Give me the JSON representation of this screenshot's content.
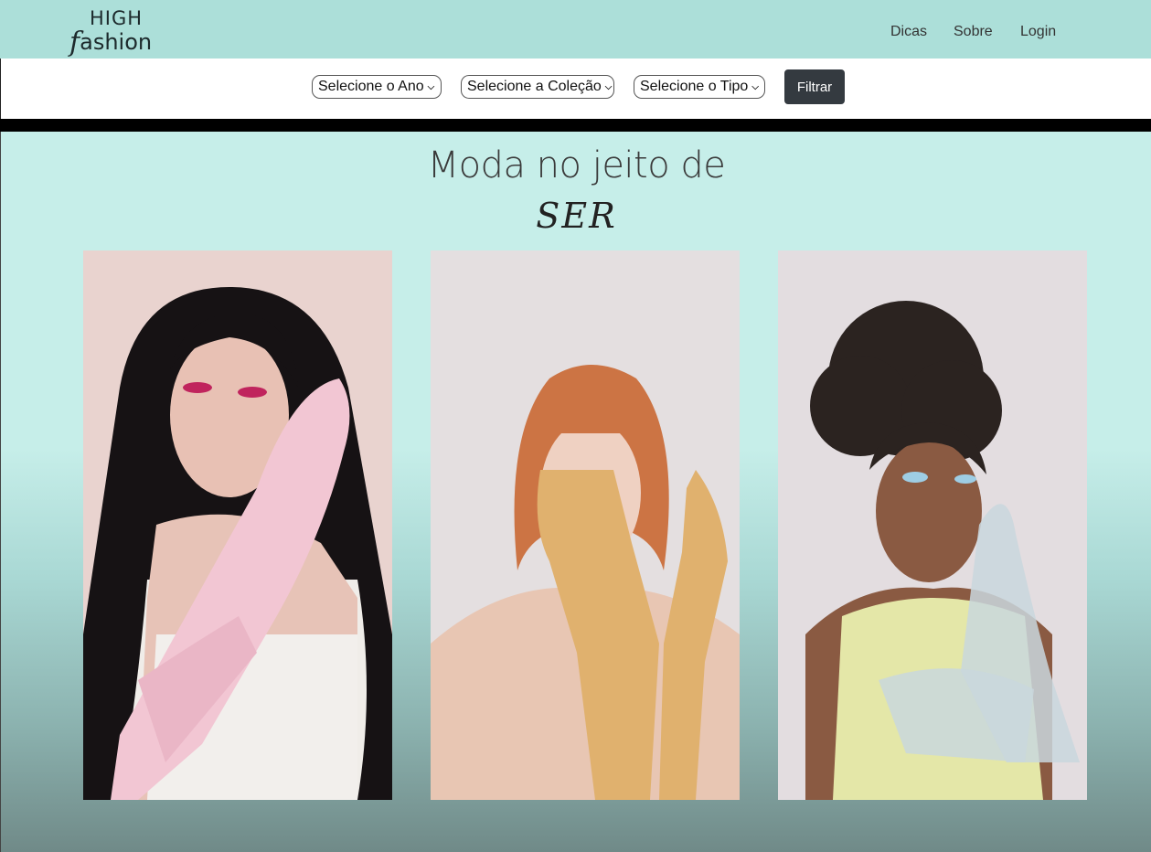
{
  "brand": {
    "line1": "HIGH",
    "line2_first": "f",
    "line2_rest": "ashion"
  },
  "nav": {
    "items": [
      {
        "label": "Dicas"
      },
      {
        "label": "Sobre"
      },
      {
        "label": "Login"
      }
    ]
  },
  "filters": {
    "year": "Selecione o Ano",
    "collection": "Selecione a Coleção",
    "type": "Selecione o Tipo",
    "button": "Filtrar"
  },
  "hero": {
    "title": "Moda no jeito de",
    "subtitle": "SER"
  },
  "gallery": [
    {
      "desc": "model-pink-gloves"
    },
    {
      "desc": "model-orange-gloves"
    },
    {
      "desc": "model-sheer-blue-gloves"
    }
  ],
  "colors": {
    "navbar": "#acdfd9",
    "hero_top": "#c6eee9",
    "hero_bottom": "#708a88",
    "button": "#343a40"
  }
}
